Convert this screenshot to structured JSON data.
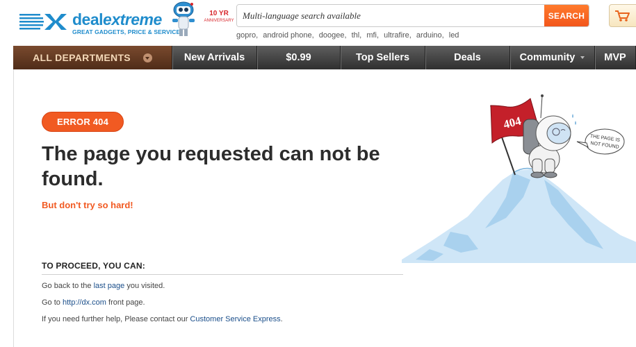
{
  "header": {
    "logo": {
      "mark": "DX",
      "brand_deal": "deal",
      "brand_extreme": "extreme",
      "tagline": "GREAT GADGETS, PRICE & SERVICE"
    },
    "anniversary": {
      "number": "10 YR",
      "text": "ANNIVERSARY"
    },
    "search": {
      "placeholder": "Multi-language search available",
      "button_label": "SEARCH"
    },
    "hot_keywords": [
      "gopro,",
      "android phone,",
      "doogee,",
      "thl,",
      "mfi,",
      "ultrafire,",
      "arduino,",
      "led"
    ],
    "cart_icon": "cart-icon"
  },
  "nav": {
    "all_departments": "ALL DEPARTMENTS",
    "items": [
      {
        "label": "New Arrivals"
      },
      {
        "label": "$0.99"
      },
      {
        "label": "Top Sellers"
      },
      {
        "label": "Deals"
      },
      {
        "label": "Community"
      },
      {
        "label": "MVP"
      }
    ]
  },
  "error": {
    "badge": "ERROR 404",
    "title": "The page you requested can not be found.",
    "subtitle": "But don't try so hard!",
    "illustration": {
      "flag_text": "404",
      "bubble_line1": "THE PAGE IS",
      "bubble_line2": "NOT FOUND"
    }
  },
  "proceed": {
    "title": "TO PROCEED, YOU CAN:",
    "line1": {
      "before": "Go back to the ",
      "link": "last page",
      "after": " you visited."
    },
    "line2": {
      "before": "Go to ",
      "link": "http://dx.com",
      "after": " front page."
    },
    "line3": {
      "before": "If you need further help, Please contact our ",
      "link": "Customer Service Express",
      "after": "."
    }
  },
  "colors": {
    "accent": "#f15a22",
    "brand_blue": "#1f8ccc",
    "link": "#1a4e8a",
    "nav_dark": "#3c3c3c",
    "nav_brown": "#5e3520"
  }
}
